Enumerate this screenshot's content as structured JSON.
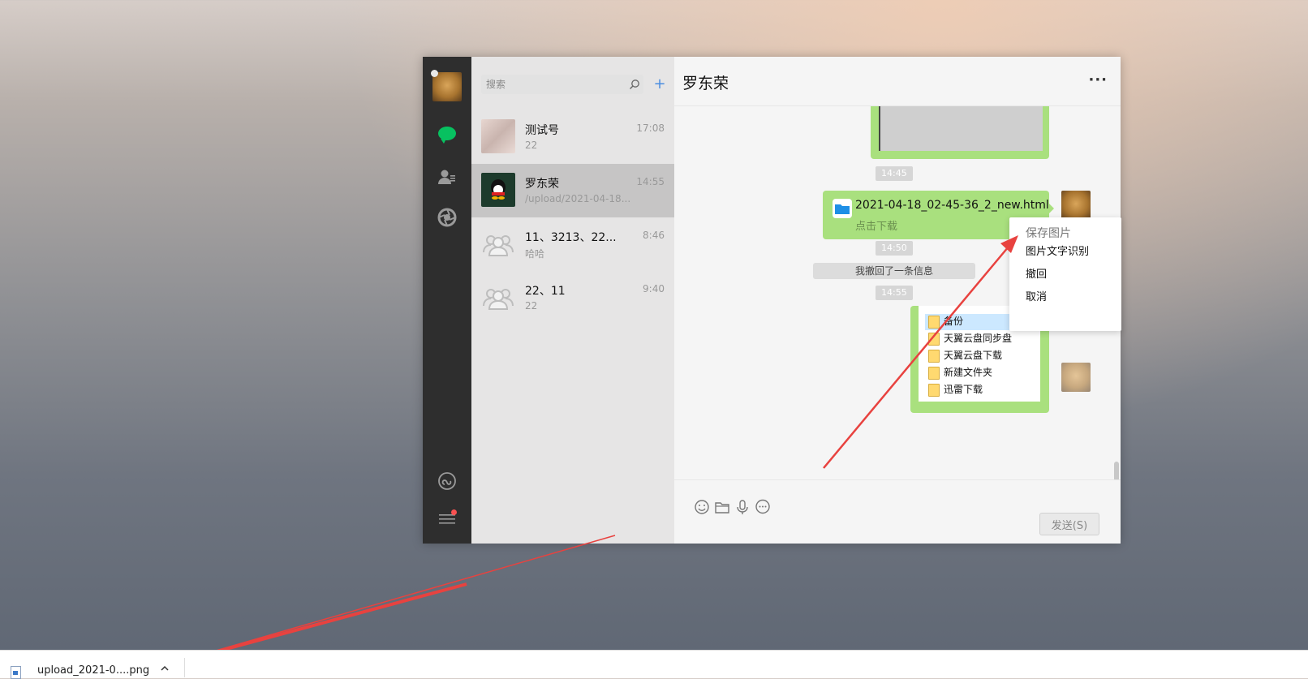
{
  "sidebar": {
    "search_placeholder": "搜索",
    "add_label": "+"
  },
  "chats": [
    {
      "name": "测试号",
      "time": "17:08",
      "preview": "22"
    },
    {
      "name": "罗东荣",
      "time": "14:55",
      "preview": "/upload/2021-04-18..."
    },
    {
      "name": "11、3213、22...",
      "time": "8:46",
      "preview": "哈哈"
    },
    {
      "name": "22、11",
      "time": "9:40",
      "preview": "22"
    }
  ],
  "conversation": {
    "title": "罗东荣",
    "more_label": "···",
    "times": [
      "14:45",
      "14:50",
      "14:55"
    ],
    "file_name": "2021-04-18_02-45-36_2_new.html",
    "file_action": "点击下载",
    "recall_notice": "我撤回了一条信息",
    "explorer_items": [
      "备份",
      "天翼云盘同步盘",
      "天翼云盘下载",
      "新建文件夹",
      "迅雷下载"
    ],
    "send_label": "发送(S)"
  },
  "context_menu": [
    "保存图片",
    "图片文字识别",
    "撤回",
    "取消"
  ],
  "download_bar": {
    "file_name": "upload_2021-0....png"
  },
  "colors": {
    "bubble_green": "#a9e07e",
    "accent_green": "#07c160",
    "annotation_red": "#e8423f"
  }
}
